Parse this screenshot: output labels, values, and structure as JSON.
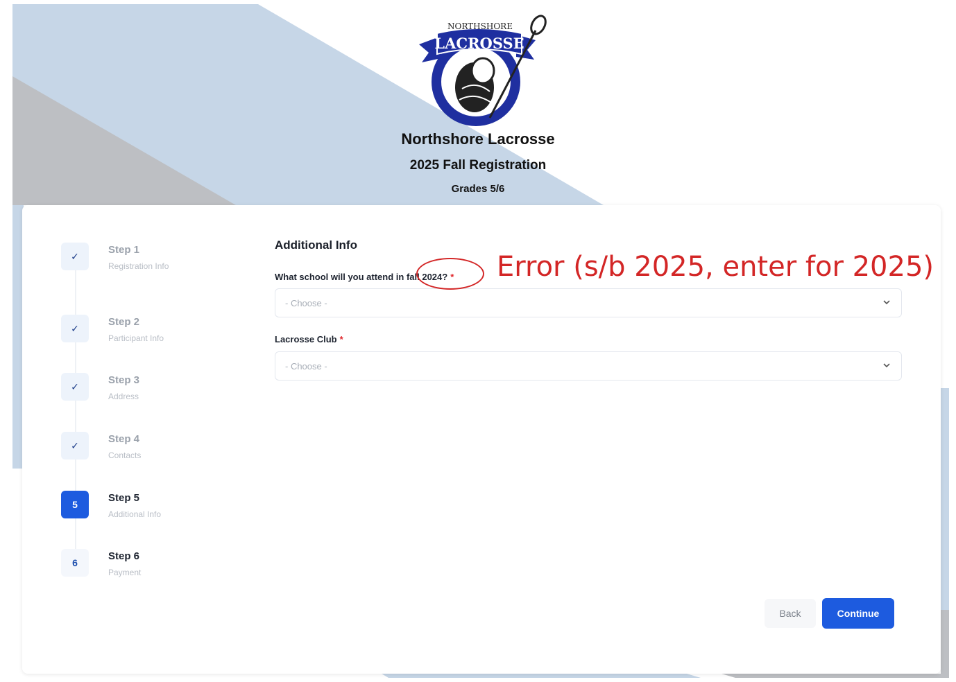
{
  "header": {
    "logo_top_text": "NORTHSHORE",
    "logo_banner_text": "LACROSSE",
    "org_name": "Northshore Lacrosse",
    "registration_title": "2025 Fall Registration",
    "grades": "Grades 5/6"
  },
  "stepper": {
    "steps": [
      {
        "label": "Step 1",
        "sub": "Registration Info",
        "state": "complete",
        "badge": "✓"
      },
      {
        "label": "Step 2",
        "sub": "Participant Info",
        "state": "complete",
        "badge": "✓"
      },
      {
        "label": "Step 3",
        "sub": "Address",
        "state": "complete",
        "badge": "✓"
      },
      {
        "label": "Step 4",
        "sub": "Contacts",
        "state": "complete",
        "badge": "✓"
      },
      {
        "label": "Step 5",
        "sub": "Additional Info",
        "state": "active",
        "badge": "5"
      },
      {
        "label": "Step 6",
        "sub": "Payment",
        "state": "pending",
        "badge": "6"
      }
    ]
  },
  "form": {
    "section_title": "Additional Info",
    "school_label": "What school will you attend in fall 2024?",
    "school_placeholder": "- Choose -",
    "club_label": "Lacrosse Club",
    "club_placeholder": "- Choose -",
    "required_mark": "*"
  },
  "annotation": {
    "error_note": "Error (s/b 2025, enter for 2025)",
    "color": "#d32626"
  },
  "actions": {
    "back_label": "Back",
    "continue_label": "Continue"
  },
  "colors": {
    "accent": "#1d5bdf",
    "banner_bg": "#c6d6e7",
    "gray_band": "#bdbfc3"
  },
  "icons": {
    "check": "checkmark-icon",
    "chevron": "chevron-down-icon"
  }
}
